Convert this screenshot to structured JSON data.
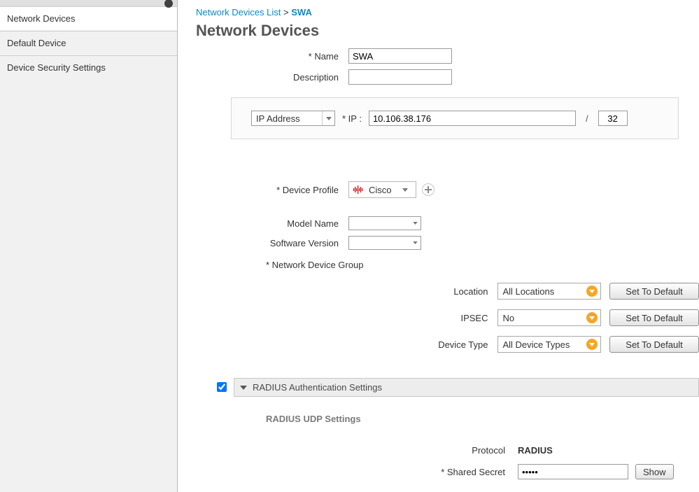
{
  "sidebar": {
    "items": [
      {
        "label": "Network Devices",
        "name": "network-devices"
      },
      {
        "label": "Default Device",
        "name": "default-device"
      },
      {
        "label": "Device Security Settings",
        "name": "device-security-settings"
      }
    ]
  },
  "breadcrumb": {
    "link_label": "Network Devices List",
    "sep": ">",
    "current": "SWA"
  },
  "page_title": "Network Devices",
  "form": {
    "name_label": "Name",
    "name_value": "SWA",
    "description_label": "Description",
    "description_value": ""
  },
  "ip_panel": {
    "type_label": "IP Address",
    "ip_label": "* IP  :",
    "ip_value": "10.106.38.176",
    "mask_value": "32"
  },
  "profile": {
    "label": "Device Profile",
    "value": "Cisco"
  },
  "model": {
    "label": "Model Name",
    "value": ""
  },
  "software": {
    "label": "Software Version",
    "value": ""
  },
  "ndg": {
    "section_label": "*  Network Device Group",
    "rows": [
      {
        "label": "Location",
        "value": "All Locations",
        "btn": "Set To Default"
      },
      {
        "label": "IPSEC",
        "value": "No",
        "btn": "Set To Default"
      },
      {
        "label": "Device Type",
        "value": "All Device Types",
        "btn": "Set To Default"
      }
    ]
  },
  "radius": {
    "checked": true,
    "section_title": "RADIUS Authentication Settings",
    "sub_title": "RADIUS UDP Settings",
    "protocol_label": "Protocol",
    "protocol_value": "RADIUS",
    "secret_label": "* Shared Secret",
    "secret_value": "•••••",
    "show_button": "Show"
  }
}
